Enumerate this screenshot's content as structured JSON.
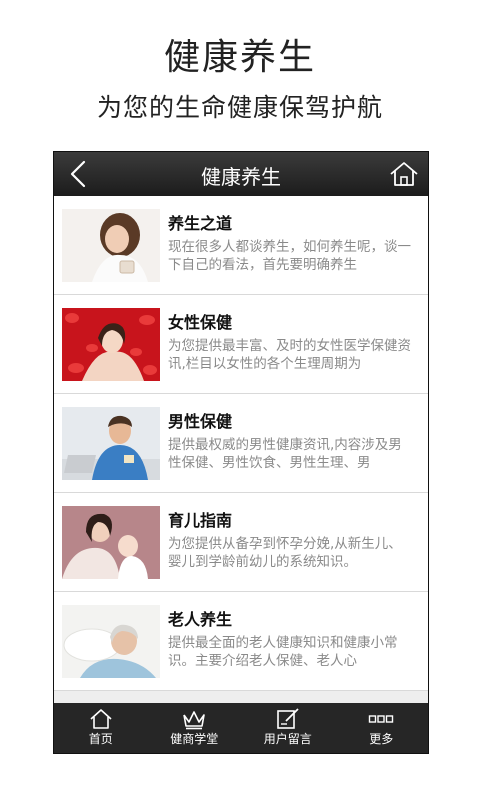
{
  "hero": {
    "title": "健康养生",
    "subtitle": "为您的生命健康保驾护航"
  },
  "app": {
    "title": "健康养生",
    "back_icon": "chevron-left-icon",
    "home_icon": "home-icon"
  },
  "items": [
    {
      "title": "养生之道",
      "description": "现在很多人都谈养生，如何养生呢，谈一下自己的看法，首先要明确养生",
      "image": "woman-with-tea-photo"
    },
    {
      "title": "女性保健",
      "description": "为您提供最丰富、及时的女性医学保健资讯,栏目以女性的各个生理周期为",
      "image": "woman-in-rose-petals-photo"
    },
    {
      "title": "男性保健",
      "description": "提供最权威的男性健康资讯,内容涉及男性保健、男性饮食、男性生理、男",
      "image": "man-at-laptop-photo"
    },
    {
      "title": "育儿指南",
      "description": "为您提供从备孕到怀孕分娩,从新生儿、婴儿到学龄前幼儿的系统知识。",
      "image": "mother-and-baby-photo"
    },
    {
      "title": "老人养生",
      "description": "提供最全面的老人健康知识和健康小常识。主要介绍老人保健、老人心",
      "image": "elderly-woman-resting-photo"
    }
  ],
  "nav": [
    {
      "label": "首页",
      "icon": "home-icon"
    },
    {
      "label": "健商学堂",
      "icon": "crown-icon"
    },
    {
      "label": "用户留言",
      "icon": "edit-note-icon"
    },
    {
      "label": "更多",
      "icon": "more-dots-icon"
    }
  ],
  "colors": {
    "titlebar": "#2b2b2b",
    "bottombar": "#262626",
    "item_title": "#111111",
    "item_desc": "#8a8a8a"
  }
}
